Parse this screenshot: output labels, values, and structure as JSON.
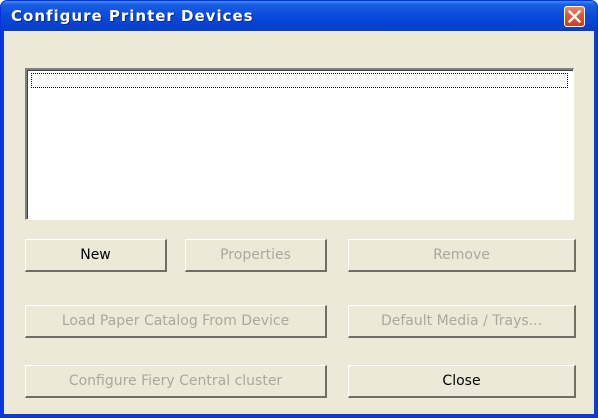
{
  "window": {
    "title": "Configure Printer Devices"
  },
  "list": {
    "items": []
  },
  "buttons": {
    "new": "New",
    "properties": "Properties",
    "remove": "Remove",
    "load_catalog": "Load Paper Catalog From Device",
    "default_media": "Default Media / Trays...",
    "configure_cluster": "Configure Fiery Central cluster",
    "close": "Close"
  },
  "state": {
    "properties_enabled": false,
    "remove_enabled": false,
    "load_catalog_enabled": false,
    "default_media_enabled": false,
    "configure_cluster_enabled": false
  },
  "icons": {
    "close": "close-icon"
  },
  "colors": {
    "titlebar": "#0a4ddb",
    "close_button": "#dd5b37",
    "dialog_face": "#ece9d8",
    "disabled_text": "#aca899"
  }
}
